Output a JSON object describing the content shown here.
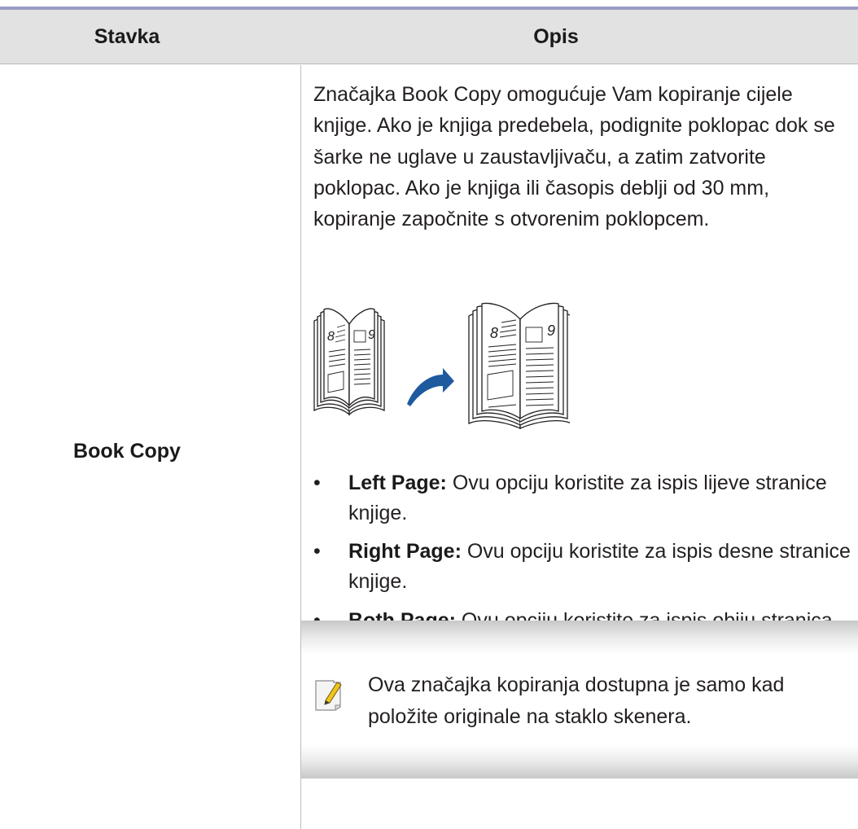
{
  "table": {
    "headers": {
      "item": "Stavka",
      "description": "Opis"
    },
    "row": {
      "item_name": "Book Copy",
      "description": "Značajka Book Copy omogućuje Vam kopiranje cijele knjige. Ako je knjiga predebela, podignite poklopac dok se šarke ne uglave u zaustavljivaču, a zatim zatvorite poklopac. Ako je knjiga ili časopis deblji od 30 mm, kopiranje započnite s otvorenim poklopcem.",
      "illustration": {
        "small_book": {
          "left_page_number": "8",
          "right_page_number": "9"
        },
        "large_book": {
          "left_page_number": "8",
          "right_page_number": "9"
        },
        "arrow_color": "#1f5a9e"
      },
      "options": [
        {
          "label": "Left Page:",
          "text": "Ovu opciju koristite za ispis lijeve stranice knjige."
        },
        {
          "label": "Right Page:",
          "text": "Ovu opciju koristite za ispis desne stranice knjige."
        },
        {
          "label": "Both Page:",
          "text": "Ovu opciju koristite za ispis obiju stranica knjige."
        }
      ],
      "note": {
        "icon": "note-pencil-icon",
        "text": "Ova značajka kopiranja dostupna je samo kad položite originale na staklo skenera."
      }
    }
  },
  "colors": {
    "top_rule": "#9a9cc3",
    "header_background": "#e2e2e2",
    "text": "#231f20",
    "note_pencil": "#f2c319"
  }
}
